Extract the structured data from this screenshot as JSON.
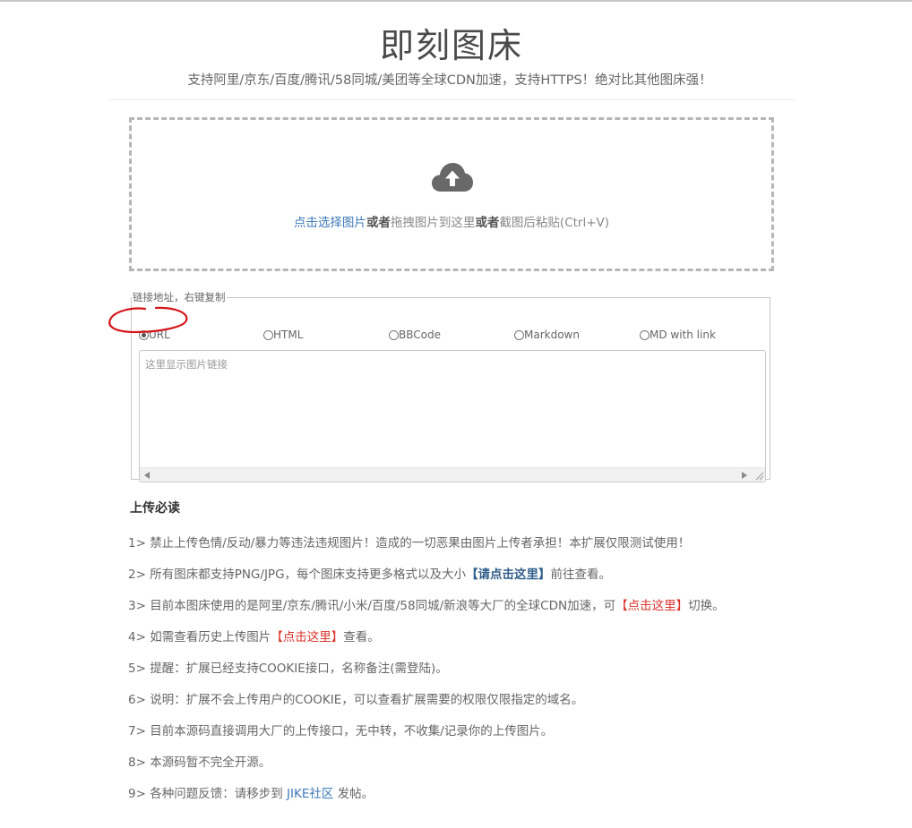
{
  "header": {
    "title": "即刻图床",
    "subtitle": "支持阿里/京东/百度/腾讯/58同城/美团等全球CDN加速，支持HTTPS！绝对比其他图床强！"
  },
  "dropzone": {
    "icon": "cloud-upload-icon",
    "link_text": "点击选择图片",
    "or1": "或者",
    "middle": "拖拽图片到这里",
    "or2": "或者",
    "end": "截图后粘贴(Ctrl+V)"
  },
  "links": {
    "legend": "链接地址，右键复制",
    "formats": [
      "URL",
      "HTML",
      "BBCode",
      "Markdown",
      "MD with link"
    ],
    "selected": "URL",
    "placeholder": "这里显示图片链接"
  },
  "notice": {
    "title": "上传必读",
    "r1": "1> 禁止上传色情/反动/暴力等违法违规图片！造成的一切恶果由图片上传者承担！本扩展仅限测试使用！",
    "r2_a": "2> 所有图床都支持PNG/JPG，每个图床支持更多格式以及大小",
    "r2_link": "【请点击这里】",
    "r2_b": "前往查看。",
    "r3_a": "3> 目前本图床使用的是阿里/京东/腾讯/小米/百度/58同城/新浪等大厂的全球CDN加速，可",
    "r3_link": "【点击这里】",
    "r3_b": "切换。",
    "r4_a": "4> 如需查看历史上传图片",
    "r4_link": "【点击这里】",
    "r4_b": "查看。",
    "r5": "5> 提醒：扩展已经支持COOKIE接口，名称备注(需登陆)。",
    "r6": "6> 说明：扩展不会上传用户的COOKIE，可以查看扩展需要的权限仅限指定的域名。",
    "r7": "7> 目前本源码直接调用大厂的上传接口，无中转，不收集/记录你的上传图片。",
    "r8": "8> 本源码暂不完全开源。",
    "r9_a": "9> 各种问题反馈：请移步到",
    "r9_link": "JIKE社区",
    "r9_b": "发帖。"
  },
  "colors": {
    "link": "#3d7ab8",
    "red": "#d9342b",
    "annotation": "#d4161c"
  }
}
